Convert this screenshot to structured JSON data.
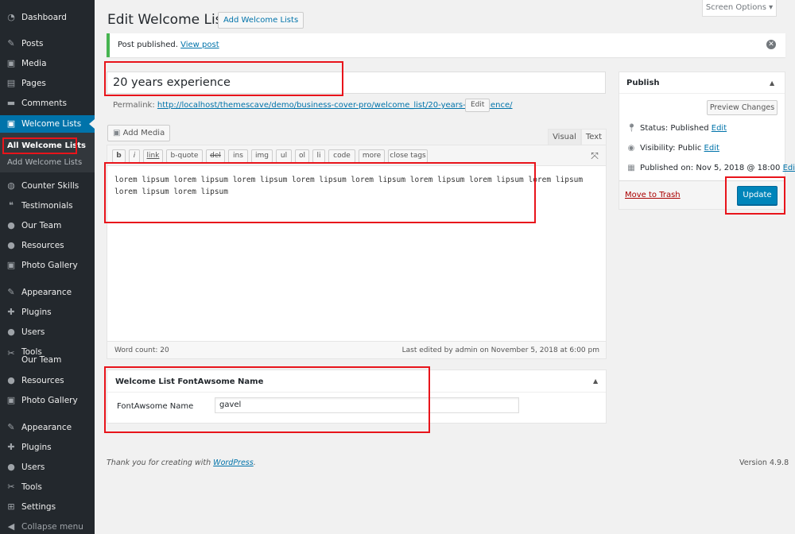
{
  "sidebar": {
    "items": [
      {
        "label": "Dashboard",
        "icon": "dashboard-icon"
      },
      {
        "label": "Posts",
        "icon": "pin-icon"
      },
      {
        "label": "Media",
        "icon": "media-icon"
      },
      {
        "label": "Pages",
        "icon": "pages-icon"
      },
      {
        "label": "Comments",
        "icon": "comments-icon"
      },
      {
        "label": "Welcome Lists",
        "icon": "welcome-lists-icon"
      },
      {
        "label": "Counter Skills",
        "icon": "gauge-icon"
      },
      {
        "label": "Testimonials",
        "icon": "quote-icon"
      },
      {
        "label": "Our Team",
        "icon": "team-icon"
      },
      {
        "label": "Resources",
        "icon": "resources-icon"
      },
      {
        "label": "Photo Gallery",
        "icon": "gallery-icon"
      },
      {
        "label": "Appearance",
        "icon": "appearance-icon"
      },
      {
        "label": "Plugins",
        "icon": "plugins-icon"
      },
      {
        "label": "Users",
        "icon": "users-icon"
      },
      {
        "label": "Tools",
        "label2": "Our Team",
        "icon": "tools-icon"
      },
      {
        "label": "Resources",
        "icon": "resources-icon"
      },
      {
        "label": "Photo Gallery",
        "icon": "gallery-icon"
      },
      {
        "label": "Appearance",
        "icon": "appearance-icon"
      },
      {
        "label": "Plugins",
        "icon": "plugins-icon"
      },
      {
        "label": "Users",
        "icon": "users-icon"
      },
      {
        "label": "Tools",
        "icon": "tools-icon"
      },
      {
        "label": "Settings",
        "icon": "settings-icon"
      },
      {
        "label": "Collapse menu",
        "icon": "collapse-icon"
      }
    ],
    "submenu": {
      "all": "All Welcome Lists",
      "add": "Add Welcome Lists"
    }
  },
  "header": {
    "title": "Edit Welcome List",
    "add_new": "Add Welcome Lists",
    "screen_options": "Screen Options ▾"
  },
  "notice": {
    "text": "Post published.",
    "link": "View post"
  },
  "post": {
    "title": "20 years experience",
    "permalink_label": "Permalink:",
    "permalink_url": "http://localhost/themescave/demo/business-cover-pro/welcome_list/20-years-experience/",
    "permalink_edit": "Edit"
  },
  "editor": {
    "add_media": "Add Media",
    "tab_visual": "Visual",
    "tab_text": "Text",
    "quicktags": [
      "b",
      "i",
      "link",
      "b-quote",
      "del",
      "ins",
      "img",
      "ul",
      "ol",
      "li",
      "code",
      "more",
      "close tags"
    ],
    "content": "lorem lipsum lorem lipsum lorem lipsum lorem lipsum lorem lipsum lorem lipsum lorem lipsum lorem lipsum lorem lipsum lorem lipsum",
    "word_count": "Word count: 20",
    "last_edited": "Last edited by admin on November 5, 2018 at 6:00 pm"
  },
  "metabox": {
    "title": "Welcome List FontAwsome Name",
    "field_label": "FontAwsome Name",
    "field_value": "gavel"
  },
  "publish": {
    "title": "Publish",
    "preview": "Preview Changes",
    "status_label": "Status:",
    "status_value": "Published",
    "visibility_label": "Visibility:",
    "visibility_value": "Public",
    "published_label": "Published on:",
    "published_value": "Nov 5, 2018 @ 18:00",
    "edit": "Edit",
    "trash": "Move to Trash",
    "update": "Update"
  },
  "footer": {
    "thanks_prefix": "Thank you for creating with",
    "thanks_link": "WordPress",
    "thanks_suffix": ".",
    "version": "Version 4.9.8"
  },
  "colors": {
    "sidebar_bg": "#23282d",
    "active_menu": "#0073aa",
    "primary_button": "#0085ba",
    "link": "#0073aa",
    "notice_success": "#46b450",
    "annotation": "#e8141b",
    "trash": "#a00"
  }
}
